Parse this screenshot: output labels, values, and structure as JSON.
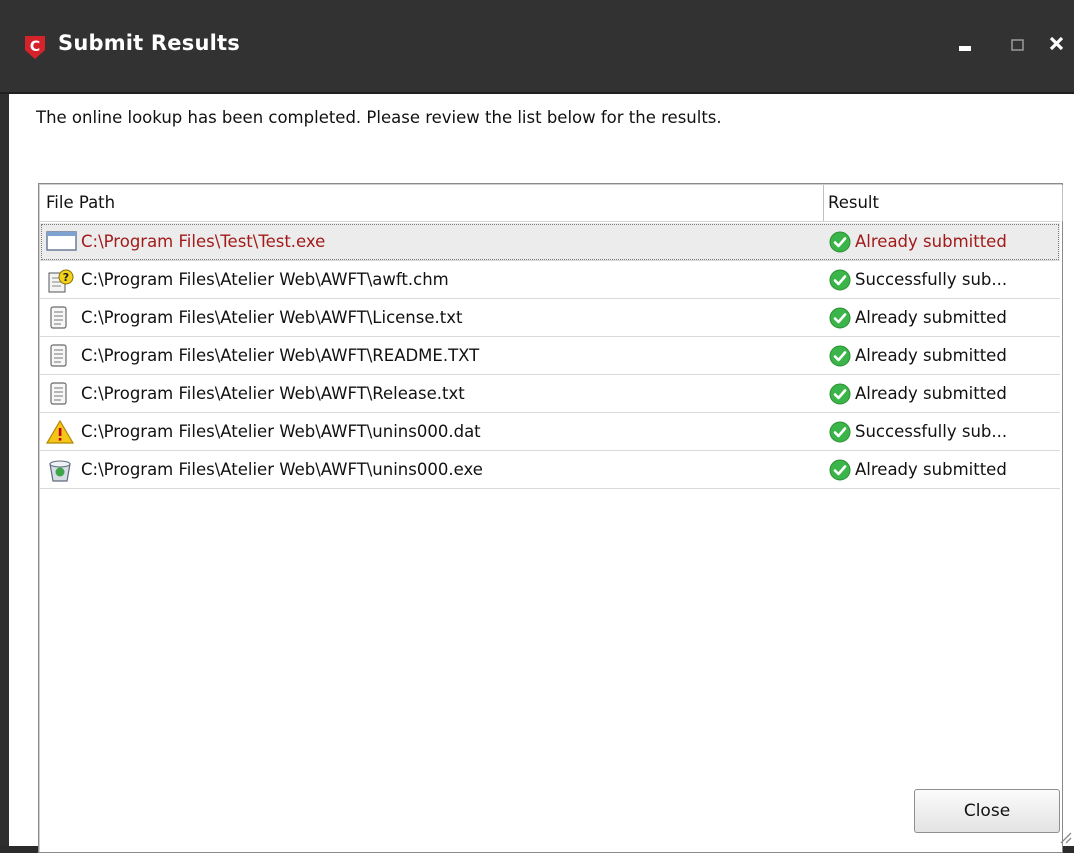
{
  "window": {
    "title": "Submit Results",
    "message": "The online lookup has been completed. Please review the list below for the results."
  },
  "list": {
    "columns": [
      "File Path",
      "Result"
    ],
    "rows": [
      {
        "icon": "application-window-icon",
        "path": "C:\\Program Files\\Test\\Test.exe",
        "result": "Already submitted",
        "selected": true
      },
      {
        "icon": "help-file-icon",
        "path": "C:\\Program Files\\Atelier Web\\AWFT\\awft.chm",
        "result": "Successfully sub...",
        "selected": false
      },
      {
        "icon": "text-document-icon",
        "path": "C:\\Program Files\\Atelier Web\\AWFT\\License.txt",
        "result": "Already submitted",
        "selected": false
      },
      {
        "icon": "text-document-icon",
        "path": "C:\\Program Files\\Atelier Web\\AWFT\\README.TXT",
        "result": "Already submitted",
        "selected": false
      },
      {
        "icon": "text-document-icon",
        "path": "C:\\Program Files\\Atelier Web\\AWFT\\Release.txt",
        "result": "Already submitted",
        "selected": false
      },
      {
        "icon": "warning-icon",
        "path": "C:\\Program Files\\Atelier Web\\AWFT\\unins000.dat",
        "result": "Successfully sub...",
        "selected": false
      },
      {
        "icon": "recycle-bin-icon",
        "path": "C:\\Program Files\\Atelier Web\\AWFT\\unins000.exe",
        "result": "Already submitted",
        "selected": false
      }
    ],
    "result_icon": "check-circle-icon"
  },
  "buttons": {
    "close_label": "Close"
  },
  "colors": {
    "titlebar": "#323232",
    "selected_text": "#a21a1a",
    "check_green": "#3bb54a",
    "logo_red": "#d4232a"
  }
}
